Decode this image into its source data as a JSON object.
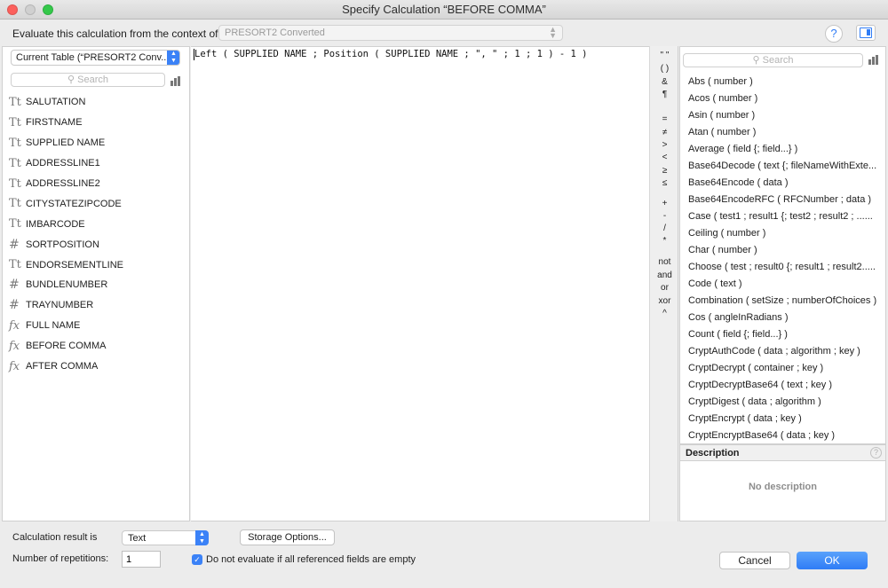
{
  "window": {
    "title": "Specify Calculation “BEFORE COMMA”",
    "colors": {
      "close": "#fc605c",
      "minimize": "#d0d0d0",
      "maximize": "#34c84a",
      "accent": "#3b82f7"
    }
  },
  "context": {
    "label": "Evaluate this calculation from the context of:",
    "value": "PRESORT2 Converted"
  },
  "left": {
    "table_selector": "Current Table (“PRESORT2 Conv...",
    "search_placeholder": "Search",
    "fields": [
      {
        "type": "text",
        "icon": "text-field-icon",
        "name": "SALUTATION"
      },
      {
        "type": "text",
        "icon": "text-field-icon",
        "name": "FIRSTNAME"
      },
      {
        "type": "text",
        "icon": "text-field-icon",
        "name": "SUPPLIED NAME"
      },
      {
        "type": "text",
        "icon": "text-field-icon",
        "name": "ADDRESSLINE1"
      },
      {
        "type": "text",
        "icon": "text-field-icon",
        "name": "ADDRESSLINE2"
      },
      {
        "type": "text",
        "icon": "text-field-icon",
        "name": "CITYSTATEZIPCODE"
      },
      {
        "type": "text",
        "icon": "text-field-icon",
        "name": "IMBARCODE"
      },
      {
        "type": "number",
        "icon": "number-field-icon",
        "name": "SORTPOSITION"
      },
      {
        "type": "text",
        "icon": "text-field-icon",
        "name": "ENDORSEMENTLINE"
      },
      {
        "type": "number",
        "icon": "number-field-icon",
        "name": "BUNDLENUMBER"
      },
      {
        "type": "number",
        "icon": "number-field-icon",
        "name": "TRAYNUMBER"
      },
      {
        "type": "calc",
        "icon": "calculation-field-icon",
        "name": "FULL NAME"
      },
      {
        "type": "calc",
        "icon": "calculation-field-icon",
        "name": "BEFORE COMMA"
      },
      {
        "type": "calc",
        "icon": "calculation-field-icon",
        "name": "AFTER COMMA"
      }
    ]
  },
  "editor": {
    "formula": "Left ( SUPPLIED NAME ; Position ( SUPPLIED NAME ; \", \" ; 1 ; 1 ) - 1 )"
  },
  "operators": [
    "\" \"",
    "( )",
    "&",
    "¶",
    "=",
    "≠",
    ">",
    "<",
    "≥",
    "≤",
    "+",
    "-",
    "/",
    "*",
    "not",
    "and",
    "or",
    "xor",
    "^"
  ],
  "functions": {
    "search_placeholder": "Search",
    "items": [
      "Abs ( number )",
      "Acos ( number )",
      "Asin ( number )",
      "Atan ( number )",
      "Average ( field {; field...} )",
      "Base64Decode ( text {; fileNameWithExte...",
      "Base64Encode ( data )",
      "Base64EncodeRFC ( RFCNumber ; data )",
      "Case ( test1 ; result1 {; test2 ; result2 ; ......",
      "Ceiling ( number )",
      "Char ( number )",
      "Choose ( test ; result0 {; result1 ; result2.....",
      "Code ( text )",
      "Combination ( setSize ; numberOfChoices )",
      "Cos ( angleInRadians )",
      "Count ( field {; field...} )",
      "CryptAuthCode ( data ; algorithm ; key )",
      "CryptDecrypt ( container ; key )",
      "CryptDecryptBase64 ( text ; key )",
      "CryptDigest ( data ; algorithm )",
      "CryptEncrypt ( data ; key )",
      "CryptEncryptBase64 ( data ; key )"
    ]
  },
  "description": {
    "header": "Description",
    "help": "?",
    "text": "No description"
  },
  "bottom": {
    "result_label": "Calculation result is",
    "result_value": "Text",
    "storage_button": "Storage Options...",
    "repetitions_label": "Number of repetitions:",
    "repetitions_value": "1",
    "checkbox_label": "Do not evaluate if all referenced fields are empty",
    "checkbox_checked": true,
    "cancel": "Cancel",
    "ok": "OK"
  },
  "help_button": "?"
}
